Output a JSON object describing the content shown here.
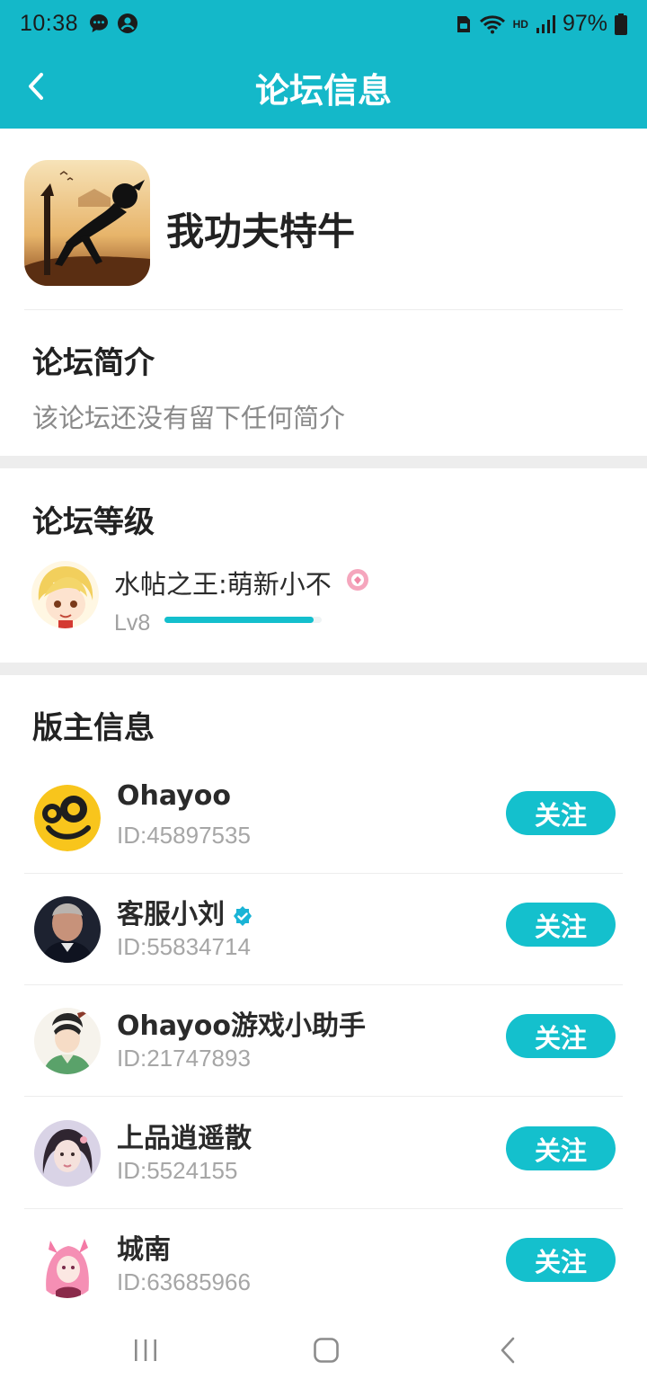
{
  "status_bar": {
    "time": "10:38",
    "battery": "97%",
    "network": "HD"
  },
  "nav": {
    "title": "论坛信息"
  },
  "forum": {
    "name": "我功夫特牛"
  },
  "intro": {
    "title": "论坛简介",
    "text": "该论坛还没有留下任何简介"
  },
  "level": {
    "title": "论坛等级",
    "name": "水帖之王:萌新小不",
    "lv": "Lv8",
    "progress": 0.95
  },
  "moderators": {
    "title": "版主信息",
    "follow_label": "关注",
    "items": [
      {
        "name": "Ohayoo",
        "id": "ID:45897535",
        "verified": false
      },
      {
        "name": "客服小刘",
        "id": "ID:55834714",
        "verified": true
      },
      {
        "name": "Ohayoo游戏小助手",
        "id": "ID:21747893",
        "verified": false
      },
      {
        "name": "上品逍遥散",
        "id": "ID:5524155",
        "verified": false
      },
      {
        "name": "城南",
        "id": "ID:63685966",
        "verified": false
      }
    ]
  },
  "colors": {
    "accent": "#14b8c9",
    "button": "#14c0cd",
    "band": "#ededed"
  },
  "icons": [
    "back-icon",
    "chat-bubble-icon",
    "account-circle-icon",
    "wifi-icon",
    "signal-icon",
    "battery-icon",
    "verified-icon",
    "recents-icon",
    "home-icon",
    "nav-back-icon"
  ]
}
